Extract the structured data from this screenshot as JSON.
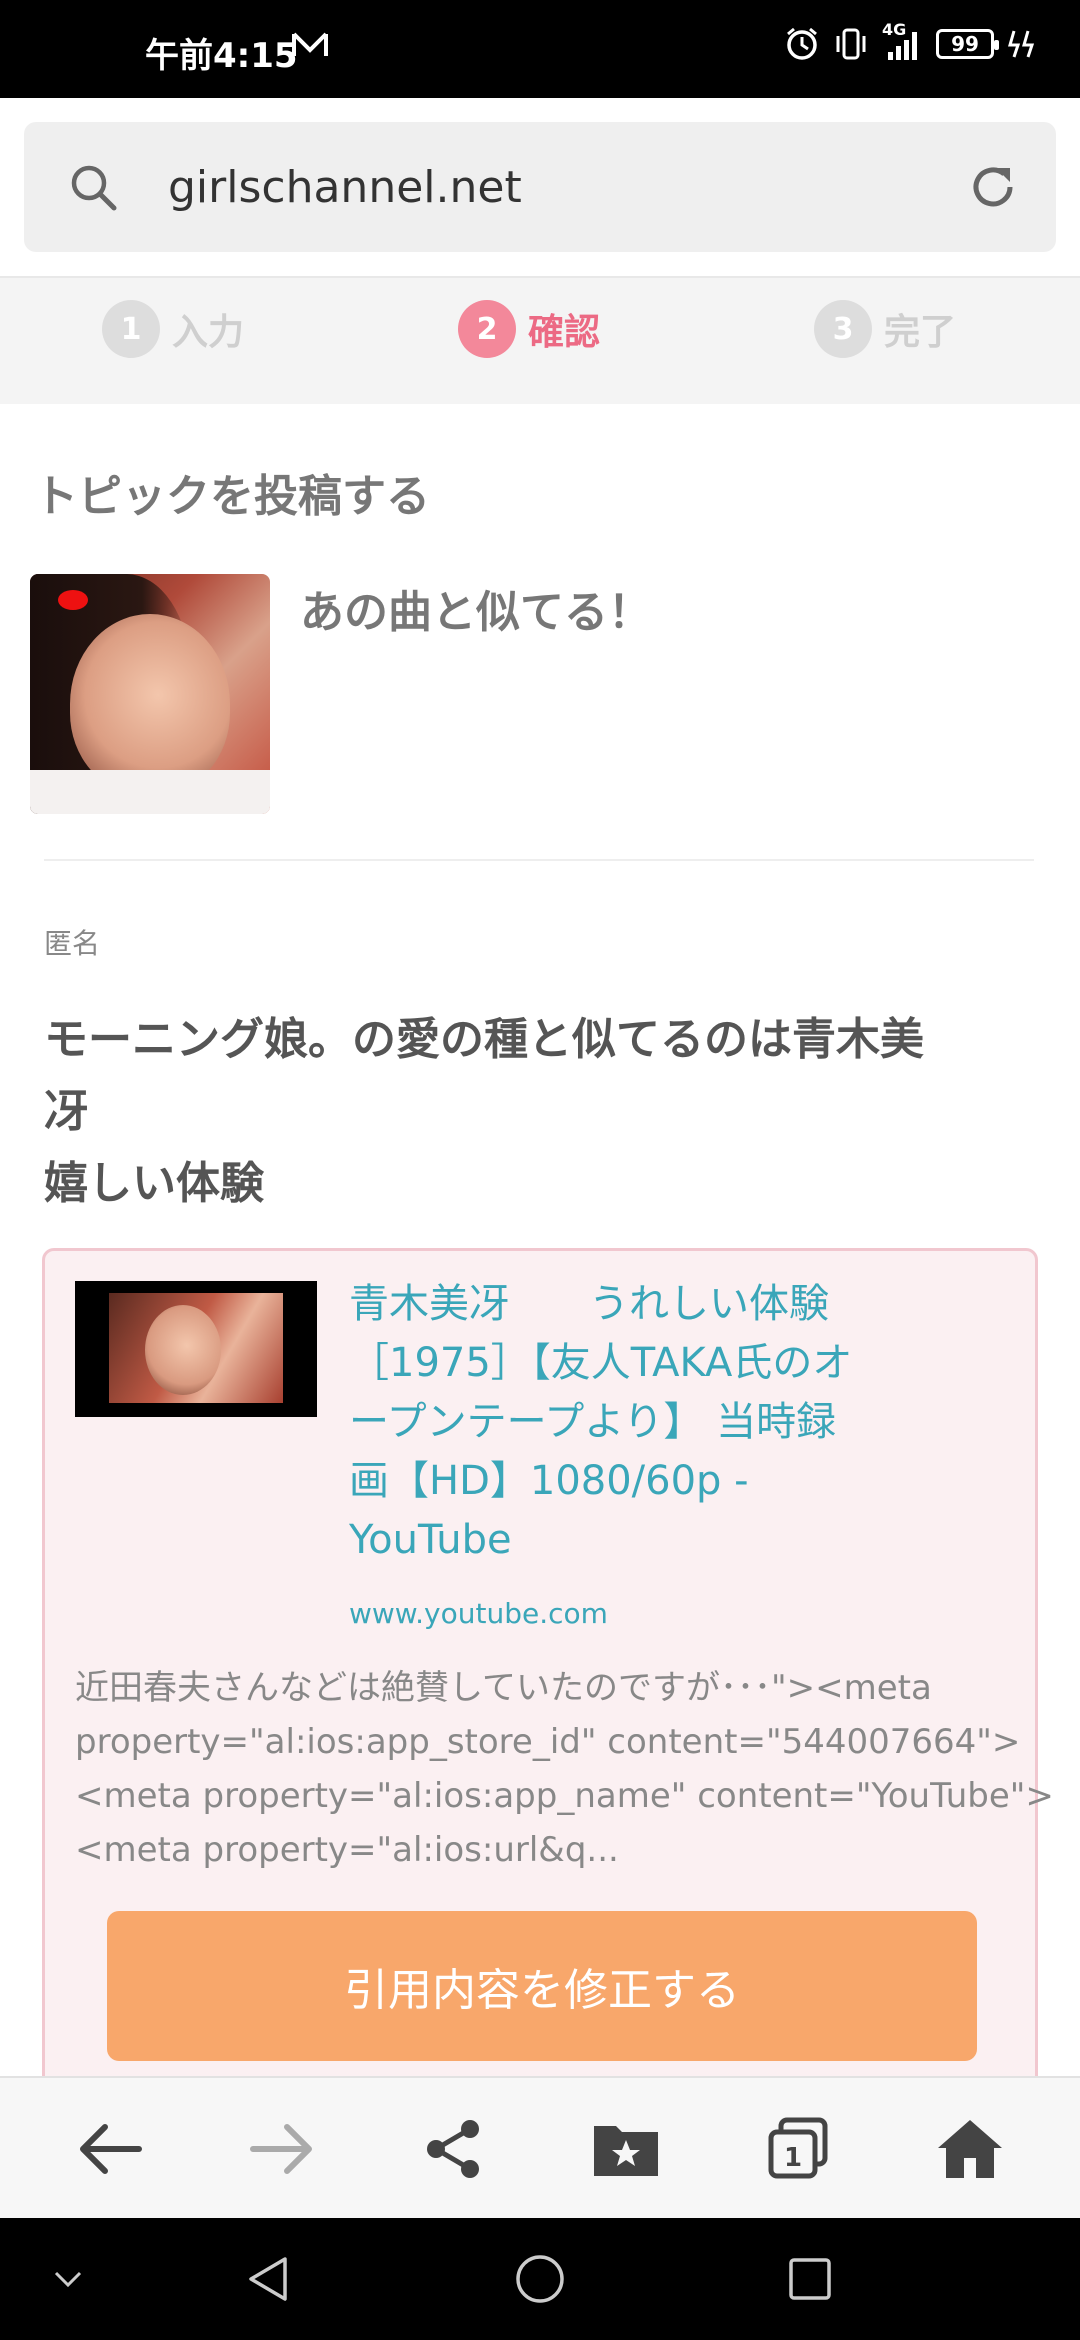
{
  "status_bar": {
    "time": "午前4:15",
    "network": "4G",
    "battery": "99"
  },
  "browser": {
    "url": "girlschannel.net"
  },
  "steps": [
    {
      "num": "1",
      "label": "入力"
    },
    {
      "num": "2",
      "label": "確認"
    },
    {
      "num": "3",
      "label": "完了"
    }
  ],
  "page": {
    "section_title": "トピックを投稿する",
    "topic_headline": "あの曲と似てる！",
    "author": "匿名",
    "comment_lines": [
      "モーニング娘。の愛の種と似てるのは青木美",
      "冴",
      "嬉しい体験"
    ]
  },
  "quote": {
    "title_lines": [
      "青木美冴　　うれしい体験",
      "［1975］【友人TAKA氏のオ",
      "ープンテープより】 当時録",
      "画【HD】1080/60p -",
      "YouTube"
    ],
    "domain": "www.youtube.com",
    "description_lines": [
      "近田春夫さんなどは絶賛していたのですが･･･\"><meta",
      "property=\"al:ios:app_store_id\" content=\"544007664\">",
      "<meta property=\"al:ios:app_name\" content=\"YouTube\">",
      "<meta property=\"al:ios:url&q..."
    ],
    "edit_button_label": "引用内容を修正する"
  },
  "toolbar": {
    "tabs_count": "1"
  },
  "icons": {
    "back": "back-arrow-icon",
    "forward": "forward-arrow-icon",
    "share": "share-icon",
    "bookmarks": "bookmark-folder-icon",
    "tabs": "tabs-icon",
    "home": "home-icon"
  }
}
